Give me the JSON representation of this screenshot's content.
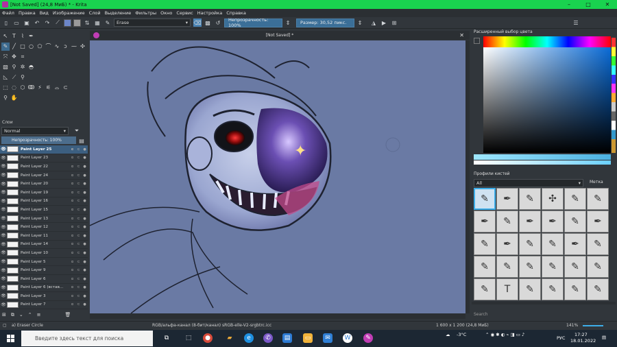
{
  "window": {
    "title": "[Not Saved]  (24,8 МиБ)  * - Krita",
    "controls": [
      "–",
      "□",
      "✕"
    ]
  },
  "menu": [
    "Файл",
    "Правка",
    "Вид",
    "Изображение",
    "Слой",
    "Выделение",
    "Фильтры",
    "Окно",
    "Сервис",
    "Настройка",
    "Справка"
  ],
  "tool_options": {
    "brush_preset": "Erase",
    "opacity_label": "Непрозрачность: 100%",
    "size_label": "Размер: 30,52 пикс."
  },
  "layers_panel": {
    "title": "Слои",
    "blend_mode": "Normal",
    "opacity_label": "Непрозрачность:  100%",
    "layers": [
      {
        "name": "Paint Layer 25",
        "selected": true
      },
      {
        "name": "Paint Layer 23"
      },
      {
        "name": "Paint Layer 22"
      },
      {
        "name": "Paint Layer 24"
      },
      {
        "name": "Paint Layer 20"
      },
      {
        "name": "Paint Layer 19"
      },
      {
        "name": "Paint Layer 16"
      },
      {
        "name": "Paint Layer 15"
      },
      {
        "name": "Paint Layer 13"
      },
      {
        "name": "Paint Layer 12"
      },
      {
        "name": "Paint Layer 11"
      },
      {
        "name": "Paint Layer 14"
      },
      {
        "name": "Paint Layer 10"
      },
      {
        "name": "Paint Layer 5"
      },
      {
        "name": "Paint Layer 9"
      },
      {
        "name": "Paint Layer 6"
      },
      {
        "name": "Paint Layer 6 (встав..."
      },
      {
        "name": "Paint Layer 3"
      },
      {
        "name": "Paint Layer 7"
      }
    ]
  },
  "document_tab": "[Not Saved]  *",
  "color_panel": {
    "title": "Расширенный выбор цвета"
  },
  "brush_panel": {
    "title": "Профили кистей",
    "filter": "All",
    "tag_label": "Метка",
    "search_placeholder": "Search"
  },
  "status": {
    "tool": "a) Eraser Circle",
    "color_space": "RGB/альфа-канал (8-бит/канал)  sRGB-elle-V2-srgbtrc.icc",
    "size": "1 600 x 1 200 (24,8 МиБ)",
    "zoom": "141%"
  },
  "taskbar": {
    "search_placeholder": "Введите здесь текст для поиска",
    "weather": "-3°C",
    "lang": "РУС",
    "time": "17:27",
    "date": "18.01.2022"
  }
}
